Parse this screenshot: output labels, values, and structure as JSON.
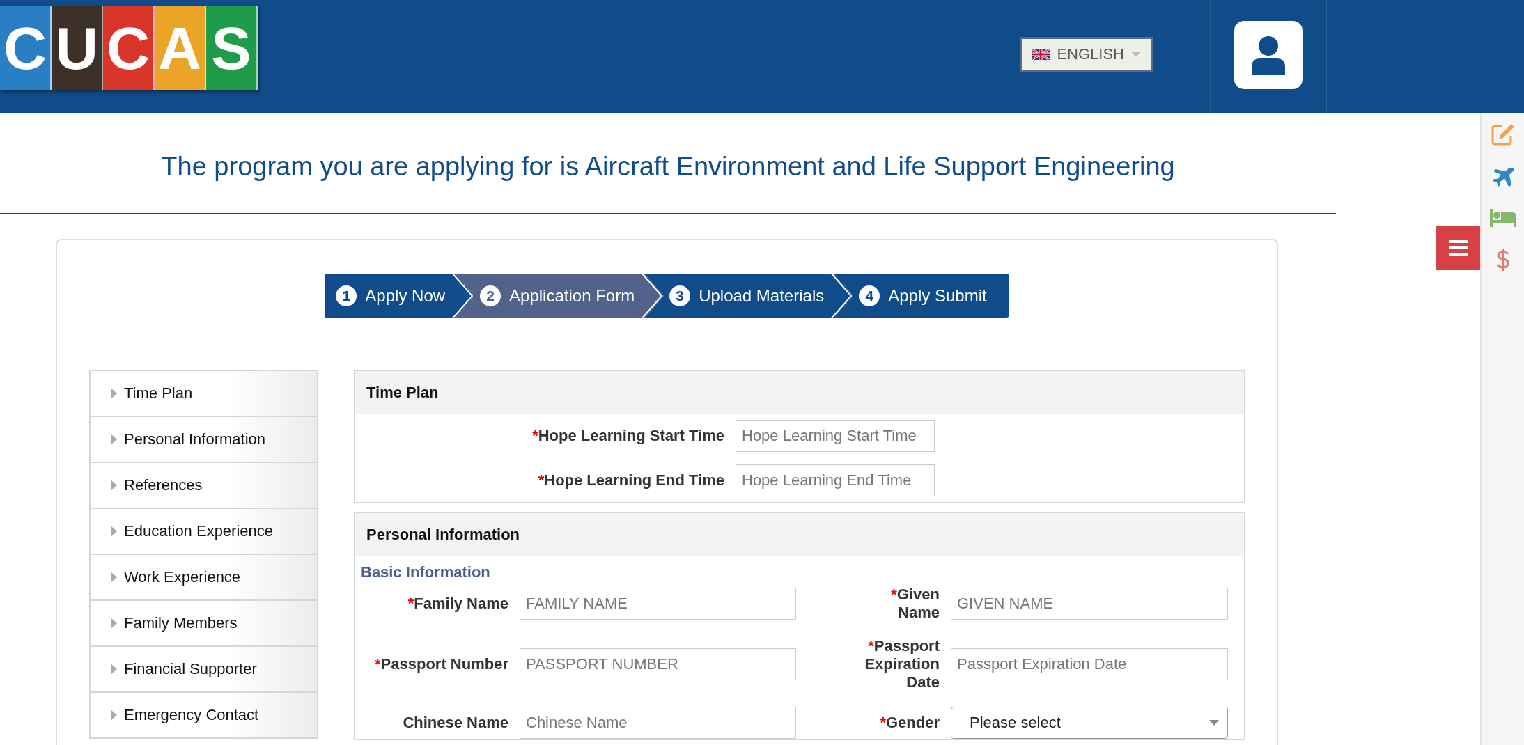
{
  "logo": [
    {
      "letter": "C",
      "color": "#2a7fc4"
    },
    {
      "letter": "U",
      "color": "#3d3029"
    },
    {
      "letter": "C",
      "color": "#d9362b"
    },
    {
      "letter": "A",
      "color": "#eaa528"
    },
    {
      "letter": "S",
      "color": "#1e9c4a"
    }
  ],
  "language": {
    "label": "ENGLISH"
  },
  "title": "The program you are applying for is Aircraft Environment and Life Support Engineering",
  "steps": [
    {
      "number": "1",
      "label": "Apply Now",
      "selected": false
    },
    {
      "number": "2",
      "label": "Application Form",
      "selected": true
    },
    {
      "number": "3",
      "label": "Upload Materials",
      "selected": false
    },
    {
      "number": "4",
      "label": "Apply Submit",
      "selected": false
    }
  ],
  "sidebar": {
    "items": [
      {
        "label": "Time Plan"
      },
      {
        "label": "Personal Information"
      },
      {
        "label": "References"
      },
      {
        "label": "Education Experience"
      },
      {
        "label": "Work Experience"
      },
      {
        "label": "Family Members"
      },
      {
        "label": "Financial Supporter"
      },
      {
        "label": "Emergency Contact"
      }
    ]
  },
  "time_plan": {
    "title": "Time Plan",
    "fields": [
      {
        "required": "*",
        "label": "Hope Learning Start Time",
        "kind": "input",
        "placeholder": "Hope Learning Start Time"
      },
      {
        "required": "*",
        "label": "Hope Learning End Time",
        "kind": "input",
        "placeholder": "Hope Learning End Time"
      }
    ]
  },
  "personal_information": {
    "title": "Personal Information",
    "subtitle": "Basic Information",
    "fields": [
      {
        "required": "*",
        "label": "Family Name",
        "kind": "input",
        "placeholder": "FAMILY NAME"
      },
      {
        "required": "*",
        "label": "Given Name",
        "kind": "input",
        "placeholder": "GIVEN NAME"
      },
      {
        "required": "*",
        "label": "Passport Number",
        "kind": "input",
        "placeholder": "PASSPORT NUMBER"
      },
      {
        "required": "*",
        "label": "Passport Expiration Date",
        "kind": "input",
        "placeholder": "Passport Expiration Date"
      },
      {
        "label": "Chinese Name",
        "kind": "input",
        "placeholder": "Chinese Name"
      },
      {
        "required": "*",
        "label": "Gender",
        "kind": "select",
        "value": "Please select"
      }
    ]
  }
}
